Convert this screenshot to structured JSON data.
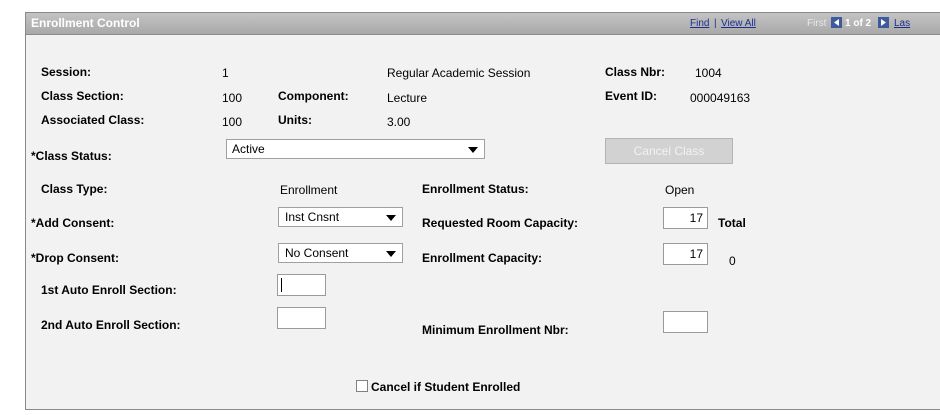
{
  "header": {
    "title": "Enrollment Control",
    "find": "Find",
    "separator": "|",
    "view_all": "View All",
    "first": "First",
    "page_indicator": "1 of 2",
    "last": "Las"
  },
  "fields": {
    "session_label": "Session:",
    "session_value": "1",
    "session_desc": "Regular Academic Session",
    "class_nbr_label": "Class Nbr:",
    "class_nbr_value": "1004",
    "class_section_label": "Class Section:",
    "class_section_value": "100",
    "component_label": "Component:",
    "component_value": "Lecture",
    "event_id_label": "Event ID:",
    "event_id_value": "000049163",
    "associated_class_label": "Associated Class:",
    "associated_class_value": "100",
    "units_label": "Units:",
    "units_value": "3.00",
    "class_status_label": "*Class Status:",
    "class_status_value": "Active",
    "cancel_class_label": "Cancel Class",
    "class_type_label": "Class Type:",
    "class_type_value": "Enrollment",
    "enrollment_status_label": "Enrollment Status:",
    "enrollment_status_value": "Open",
    "add_consent_label": "*Add Consent:",
    "add_consent_value": "Inst Cnsnt",
    "requested_room_capacity_label": "Requested Room Capacity:",
    "requested_room_capacity_value": "17",
    "total_label": "Total",
    "drop_consent_label": "*Drop Consent:",
    "drop_consent_value": "No Consent",
    "enrollment_capacity_label": "Enrollment Capacity:",
    "enrollment_capacity_value": "17",
    "enrollment_total_value": "0",
    "auto_enroll_1_label": "1st Auto Enroll Section:",
    "auto_enroll_1_value": "",
    "auto_enroll_2_label": "2nd Auto Enroll Section:",
    "auto_enroll_2_value": "",
    "min_enrollment_label": "Minimum Enrollment Nbr:",
    "min_enrollment_value": "",
    "cancel_if_enrolled_label": "Cancel if Student Enrolled",
    "cancel_if_enrolled_checked": false
  },
  "colors": {
    "link": "#1a2f8f",
    "panel_bg": "#f2f2f2",
    "header_bg": "#b0b0b0"
  }
}
